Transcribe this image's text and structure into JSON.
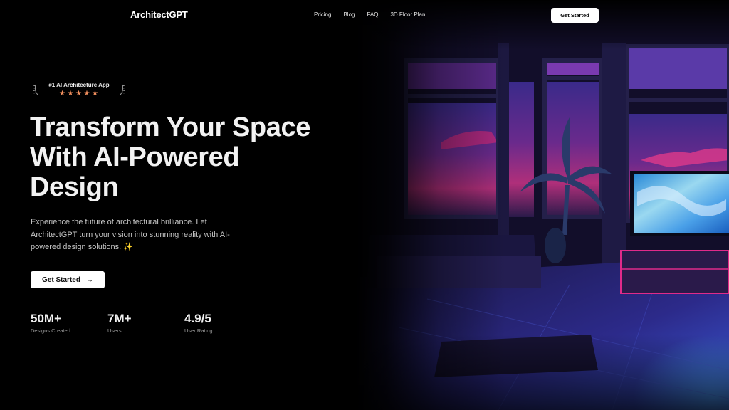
{
  "nav": {
    "logo": "ArchitectGPT",
    "links": [
      "Pricing",
      "Blog",
      "FAQ",
      "3D Floor Plan"
    ],
    "cta": "Get Started"
  },
  "badge": {
    "text": "#1 AI Architecture App",
    "rating_stars": 5
  },
  "hero": {
    "headline_lines": [
      "Transform Your Space",
      "With AI-Powered",
      "Design"
    ],
    "subtext": "Experience the future of architectural brilliance. Let ArchitectGPT turn your vision into stunning reality with AI-powered design solutions. ✨",
    "cta": "Get Started",
    "cta_icon": "arrow-right-icon"
  },
  "stats": [
    {
      "value": "50M+",
      "label": "Designs Created"
    },
    {
      "value": "7M+",
      "label": "Users"
    },
    {
      "value": "4.9/5",
      "label": "User Rating"
    }
  ],
  "colors": {
    "background": "#000000",
    "accent_star": "#f4915f",
    "button_bg": "#ffffff"
  }
}
